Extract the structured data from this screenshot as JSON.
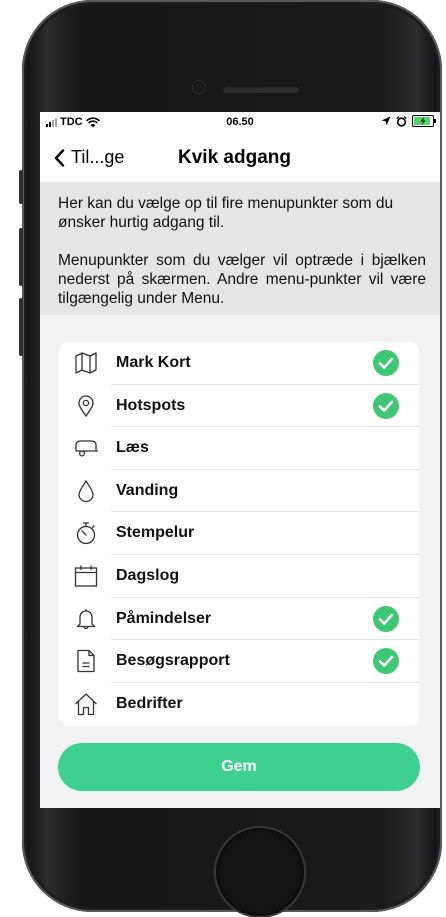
{
  "statusbar": {
    "carrier": "TDC",
    "time": "06.50",
    "wifi_icon": "wifi-icon",
    "location_icon": "location-arrow-icon",
    "alarm_icon": "alarm-icon",
    "battery_icon": "battery-charging-icon"
  },
  "navbar": {
    "back_label": "Til...ge",
    "title": "Kvik adgang"
  },
  "intro": {
    "paragraph1": "Her kan du vælge op til fire menupunkter som du ønsker hurtig adgang til.",
    "paragraph2": "Menupunkter som du vælger vil optræde i bjælken nederst på skærmen. Andre menu-punkter vil være tilgængelig under Menu."
  },
  "colors": {
    "accent": "#3dd08f",
    "check": "#3ec774"
  },
  "menu_items": [
    {
      "label": "Mark Kort",
      "icon": "map-icon",
      "selected": true
    },
    {
      "label": "Hotspots",
      "icon": "location-pin-icon",
      "selected": true
    },
    {
      "label": "Læs",
      "icon": "trailer-icon",
      "selected": false
    },
    {
      "label": "Vanding",
      "icon": "water-drop-icon",
      "selected": false
    },
    {
      "label": "Stempelur",
      "icon": "stopwatch-icon",
      "selected": false
    },
    {
      "label": "Dagslog",
      "icon": "calendar-icon",
      "selected": false
    },
    {
      "label": "Påmindelser",
      "icon": "bell-icon",
      "selected": true
    },
    {
      "label": "Besøgsrapport",
      "icon": "document-icon",
      "selected": true
    },
    {
      "label": "Bedrifter",
      "icon": "home-icon",
      "selected": false
    }
  ],
  "save_button": {
    "label": "Gem"
  }
}
